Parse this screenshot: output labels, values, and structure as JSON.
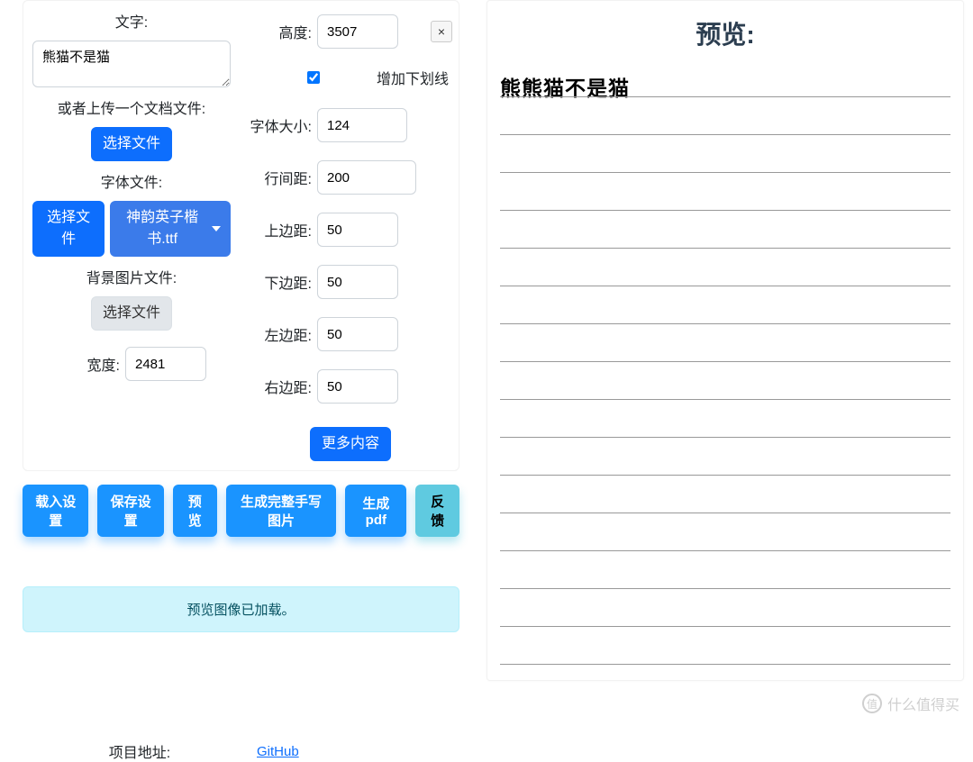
{
  "left": {
    "text_label": "文字:",
    "text_value": "熊猫不是猫",
    "upload_doc_label": "或者上传一个文档文件:",
    "choose_file": "选择文件",
    "font_file_label": "字体文件:",
    "font_dropdown": "神韵英子楷书.ttf",
    "bg_image_label": "背景图片文件:",
    "width_label": "宽度:",
    "width_value": "2481"
  },
  "right": {
    "height_label": "高度:",
    "height_value": "3507",
    "underline_label": "增加下划线",
    "font_size_label": "字体大小:",
    "font_size_value": "124",
    "line_gap_label": "行间距:",
    "line_gap_value": "200",
    "margin_top_label": "上边距:",
    "margin_top_value": "50",
    "margin_bottom_label": "下边距:",
    "margin_bottom_value": "50",
    "margin_left_label": "左边距:",
    "margin_left_value": "50",
    "margin_right_label": "右边距:",
    "margin_right_value": "50",
    "more_btn": "更多内容"
  },
  "actions": {
    "load": "载入设置",
    "save": "保存设置",
    "preview": "预览",
    "gen_img": "生成完整手写图片",
    "gen_pdf": "生成pdf",
    "feedback": "反馈"
  },
  "alert_text": "预览图像已加载。",
  "project_label": "项目地址:",
  "github": "GitHub",
  "preview": {
    "title": "预览:",
    "sample_text": "熊熊猫不是猫"
  },
  "watermark": {
    "icon": "值",
    "text": "什么值得买"
  }
}
